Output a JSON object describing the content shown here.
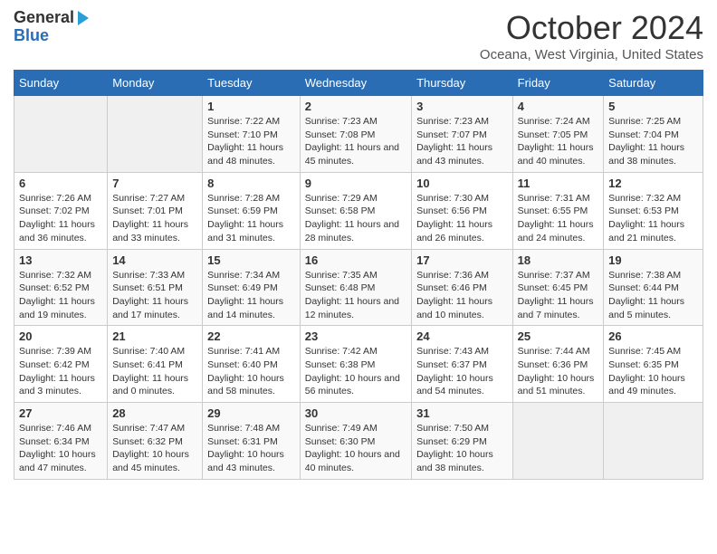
{
  "logo": {
    "general": "General",
    "blue": "Blue"
  },
  "title": "October 2024",
  "location": "Oceana, West Virginia, United States",
  "days_of_week": [
    "Sunday",
    "Monday",
    "Tuesday",
    "Wednesday",
    "Thursday",
    "Friday",
    "Saturday"
  ],
  "weeks": [
    [
      {
        "day": "",
        "content": ""
      },
      {
        "day": "",
        "content": ""
      },
      {
        "day": "1",
        "content": "Sunrise: 7:22 AM\nSunset: 7:10 PM\nDaylight: 11 hours and 48 minutes."
      },
      {
        "day": "2",
        "content": "Sunrise: 7:23 AM\nSunset: 7:08 PM\nDaylight: 11 hours and 45 minutes."
      },
      {
        "day": "3",
        "content": "Sunrise: 7:23 AM\nSunset: 7:07 PM\nDaylight: 11 hours and 43 minutes."
      },
      {
        "day": "4",
        "content": "Sunrise: 7:24 AM\nSunset: 7:05 PM\nDaylight: 11 hours and 40 minutes."
      },
      {
        "day": "5",
        "content": "Sunrise: 7:25 AM\nSunset: 7:04 PM\nDaylight: 11 hours and 38 minutes."
      }
    ],
    [
      {
        "day": "6",
        "content": "Sunrise: 7:26 AM\nSunset: 7:02 PM\nDaylight: 11 hours and 36 minutes."
      },
      {
        "day": "7",
        "content": "Sunrise: 7:27 AM\nSunset: 7:01 PM\nDaylight: 11 hours and 33 minutes."
      },
      {
        "day": "8",
        "content": "Sunrise: 7:28 AM\nSunset: 6:59 PM\nDaylight: 11 hours and 31 minutes."
      },
      {
        "day": "9",
        "content": "Sunrise: 7:29 AM\nSunset: 6:58 PM\nDaylight: 11 hours and 28 minutes."
      },
      {
        "day": "10",
        "content": "Sunrise: 7:30 AM\nSunset: 6:56 PM\nDaylight: 11 hours and 26 minutes."
      },
      {
        "day": "11",
        "content": "Sunrise: 7:31 AM\nSunset: 6:55 PM\nDaylight: 11 hours and 24 minutes."
      },
      {
        "day": "12",
        "content": "Sunrise: 7:32 AM\nSunset: 6:53 PM\nDaylight: 11 hours and 21 minutes."
      }
    ],
    [
      {
        "day": "13",
        "content": "Sunrise: 7:32 AM\nSunset: 6:52 PM\nDaylight: 11 hours and 19 minutes."
      },
      {
        "day": "14",
        "content": "Sunrise: 7:33 AM\nSunset: 6:51 PM\nDaylight: 11 hours and 17 minutes."
      },
      {
        "day": "15",
        "content": "Sunrise: 7:34 AM\nSunset: 6:49 PM\nDaylight: 11 hours and 14 minutes."
      },
      {
        "day": "16",
        "content": "Sunrise: 7:35 AM\nSunset: 6:48 PM\nDaylight: 11 hours and 12 minutes."
      },
      {
        "day": "17",
        "content": "Sunrise: 7:36 AM\nSunset: 6:46 PM\nDaylight: 11 hours and 10 minutes."
      },
      {
        "day": "18",
        "content": "Sunrise: 7:37 AM\nSunset: 6:45 PM\nDaylight: 11 hours and 7 minutes."
      },
      {
        "day": "19",
        "content": "Sunrise: 7:38 AM\nSunset: 6:44 PM\nDaylight: 11 hours and 5 minutes."
      }
    ],
    [
      {
        "day": "20",
        "content": "Sunrise: 7:39 AM\nSunset: 6:42 PM\nDaylight: 11 hours and 3 minutes."
      },
      {
        "day": "21",
        "content": "Sunrise: 7:40 AM\nSunset: 6:41 PM\nDaylight: 11 hours and 0 minutes."
      },
      {
        "day": "22",
        "content": "Sunrise: 7:41 AM\nSunset: 6:40 PM\nDaylight: 10 hours and 58 minutes."
      },
      {
        "day": "23",
        "content": "Sunrise: 7:42 AM\nSunset: 6:38 PM\nDaylight: 10 hours and 56 minutes."
      },
      {
        "day": "24",
        "content": "Sunrise: 7:43 AM\nSunset: 6:37 PM\nDaylight: 10 hours and 54 minutes."
      },
      {
        "day": "25",
        "content": "Sunrise: 7:44 AM\nSunset: 6:36 PM\nDaylight: 10 hours and 51 minutes."
      },
      {
        "day": "26",
        "content": "Sunrise: 7:45 AM\nSunset: 6:35 PM\nDaylight: 10 hours and 49 minutes."
      }
    ],
    [
      {
        "day": "27",
        "content": "Sunrise: 7:46 AM\nSunset: 6:34 PM\nDaylight: 10 hours and 47 minutes."
      },
      {
        "day": "28",
        "content": "Sunrise: 7:47 AM\nSunset: 6:32 PM\nDaylight: 10 hours and 45 minutes."
      },
      {
        "day": "29",
        "content": "Sunrise: 7:48 AM\nSunset: 6:31 PM\nDaylight: 10 hours and 43 minutes."
      },
      {
        "day": "30",
        "content": "Sunrise: 7:49 AM\nSunset: 6:30 PM\nDaylight: 10 hours and 40 minutes."
      },
      {
        "day": "31",
        "content": "Sunrise: 7:50 AM\nSunset: 6:29 PM\nDaylight: 10 hours and 38 minutes."
      },
      {
        "day": "",
        "content": ""
      },
      {
        "day": "",
        "content": ""
      }
    ]
  ]
}
